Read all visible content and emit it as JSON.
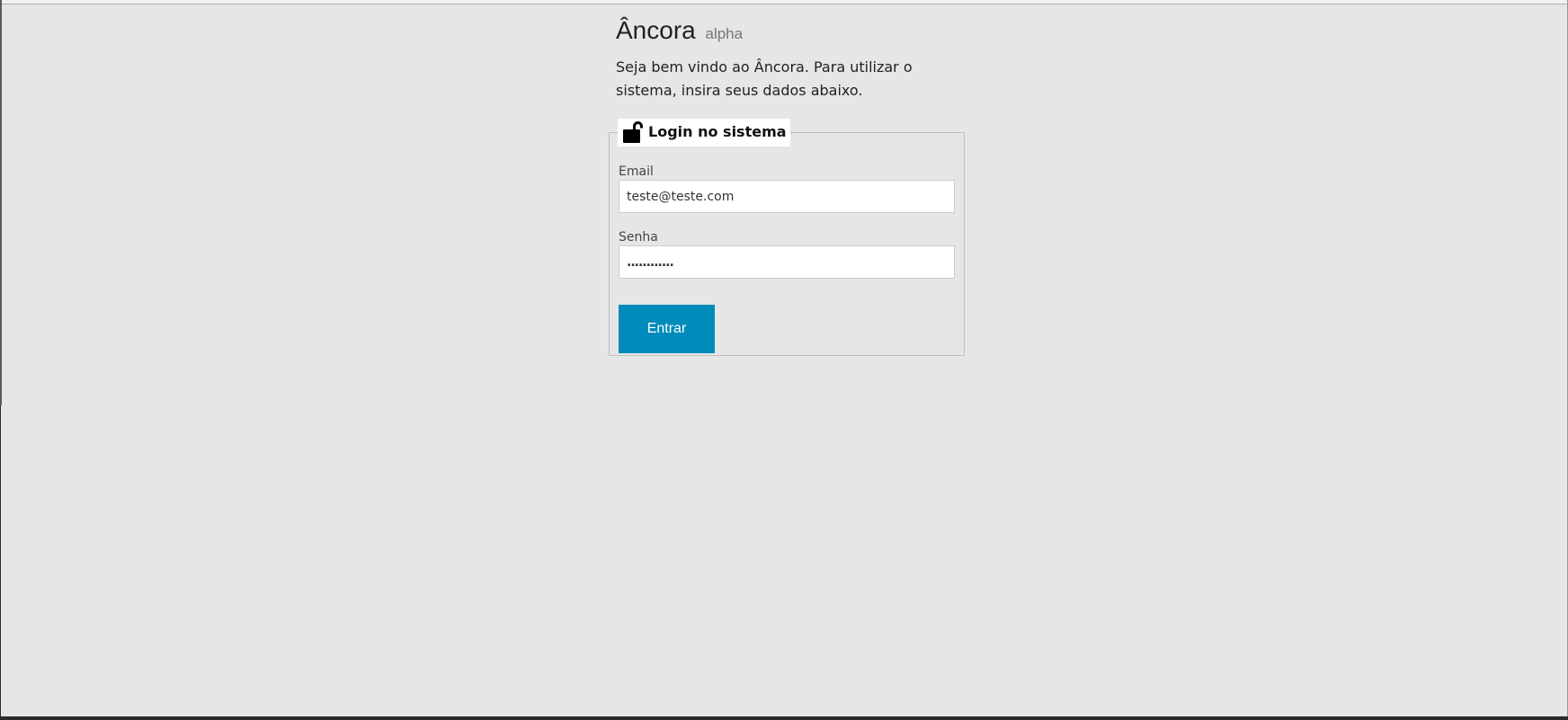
{
  "app": {
    "title": "Âncora",
    "badge": "alpha"
  },
  "intro": {
    "text": "Seja bem vindo ao Âncora. Para utilizar o sistema, insira seus dados abaixo."
  },
  "login": {
    "legend": "Login no sistema",
    "legend_icon": "unlocked-padlock-icon",
    "email": {
      "label": "Email",
      "value": "teste@teste.com"
    },
    "password": {
      "label": "Senha",
      "value": "............"
    },
    "submit_label": "Entrar"
  },
  "colors": {
    "background": "#e6e6e6",
    "button": "#008cba",
    "button_text": "#ffffff",
    "fieldset_border": "#bfbfbf"
  }
}
